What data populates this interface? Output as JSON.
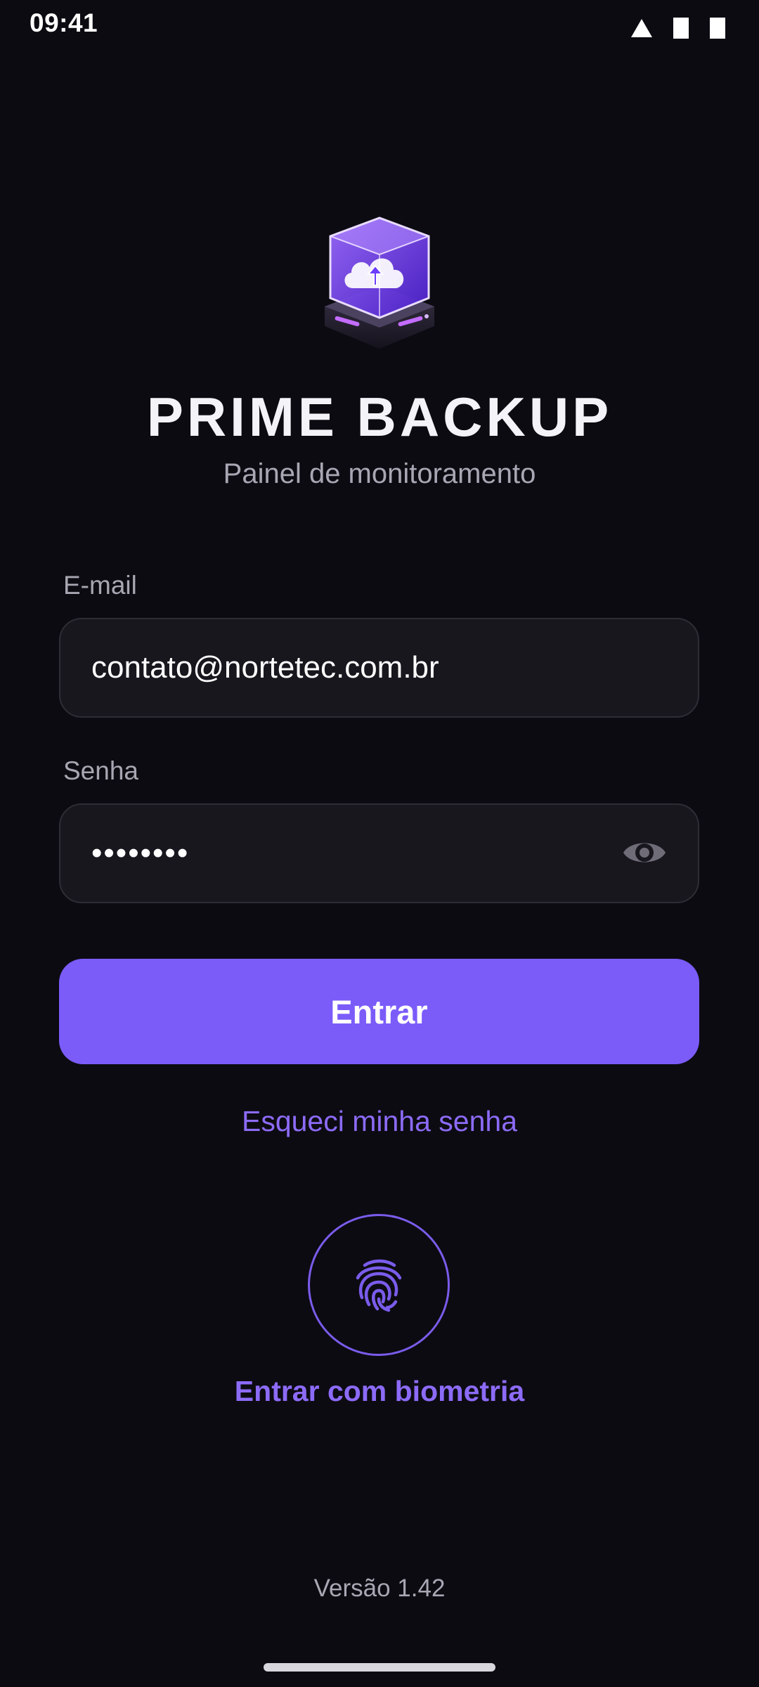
{
  "status_bar": {
    "time": "09:41",
    "icons": [
      "signal-icon",
      "wifi-icon",
      "battery-icon"
    ]
  },
  "app": {
    "name": "PRIME BACKUP",
    "subtitle": "Painel de monitoramento",
    "logo_icon": "cloud-upload-cube-logo"
  },
  "form": {
    "email_label": "E-mail",
    "email_value": "contato@nortetec.com.br",
    "password_label": "Senha",
    "password_masked": "••••••••",
    "password_toggle_icon": "eye-icon",
    "submit_label": "Entrar",
    "forgot_label": "Esqueci minha senha"
  },
  "biometric": {
    "icon": "fingerprint-icon",
    "label": "Entrar com biometria"
  },
  "footer": {
    "version": "Versão 1.42"
  },
  "colors": {
    "background": "#0c0b12",
    "accent": "#7b5cf9",
    "link": "#8c6bf7",
    "field_bg": "#18171e",
    "muted_text": "#a9a7b3"
  }
}
